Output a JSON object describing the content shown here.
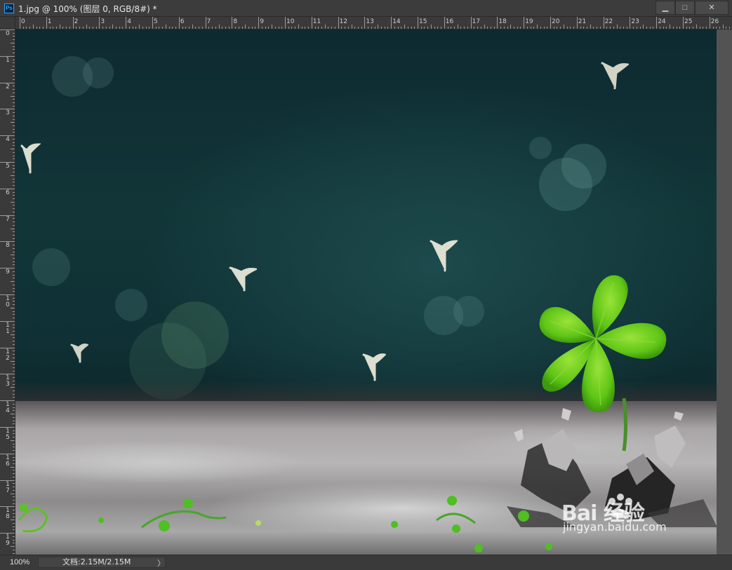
{
  "window": {
    "title": "1.jpg @ 100% (图层 0, RGB/8#) *",
    "app_icon": "Ps",
    "controls": {
      "minimize": "▁",
      "maximize": "□",
      "close": "✕"
    }
  },
  "rulers": {
    "top_labels": [
      "0",
      "1",
      "2",
      "3",
      "4",
      "5",
      "6",
      "7",
      "8",
      "9",
      "10",
      "11",
      "12",
      "13",
      "14",
      "15",
      "16",
      "17",
      "18",
      "19",
      "20",
      "21",
      "22",
      "23",
      "24",
      "25",
      "26"
    ],
    "left_labels": [
      "0",
      "1",
      "2",
      "3",
      "4",
      "5",
      "6",
      "7",
      "8",
      "9",
      "10",
      "11",
      "12",
      "13",
      "14",
      "15",
      "16",
      "17",
      "18",
      "19"
    ]
  },
  "canvas": {
    "image": "four-leaf clover sprouting from cracked ground, bokeh, teal background"
  },
  "watermark": {
    "brand": "Bai  经验",
    "url": "jingyan.baidu.com"
  },
  "statusbar": {
    "zoom": "100%",
    "doc_info": "文档:2.15M/2.15M",
    "arrow": "〉"
  },
  "colors": {
    "ui_dark": "#3a3a3a",
    "canvas_bg": "#123638",
    "clover": "#6dd11a"
  }
}
